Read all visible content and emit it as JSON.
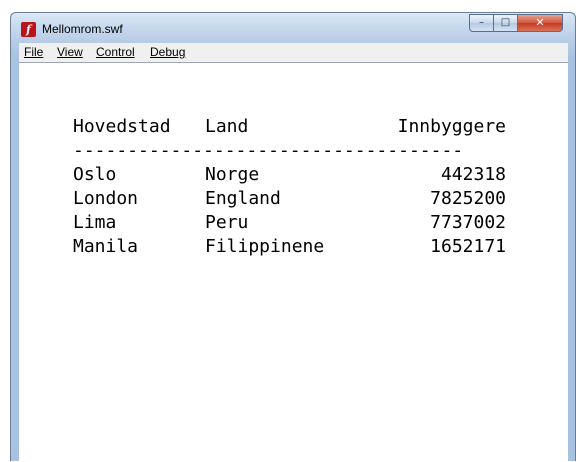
{
  "window": {
    "title": "Mellomrom.swf",
    "icon": "flash-player-icon",
    "buttons": {
      "minimize": "–",
      "maximize": "□",
      "close": "✕"
    }
  },
  "menu": {
    "items": [
      {
        "label": "File"
      },
      {
        "label": "View"
      },
      {
        "label": "Control"
      },
      {
        "label": "Debug"
      }
    ]
  },
  "table": {
    "headers": {
      "city": "Hovedstad",
      "country": "Land",
      "population": "Innbyggere"
    },
    "separator": "------------------------------------",
    "rows": [
      {
        "city": "Oslo",
        "country": "Norge",
        "population": "442318"
      },
      {
        "city": "London",
        "country": "England",
        "population": "7825200"
      },
      {
        "city": "Lima",
        "country": "Peru",
        "population": "7737002"
      },
      {
        "city": "Manila",
        "country": "Filippinene",
        "population": "1652171"
      }
    ]
  },
  "colors": {
    "close_button": "#c43a1f",
    "icon_red": "#b8141b",
    "frame": "#b8cde6"
  }
}
